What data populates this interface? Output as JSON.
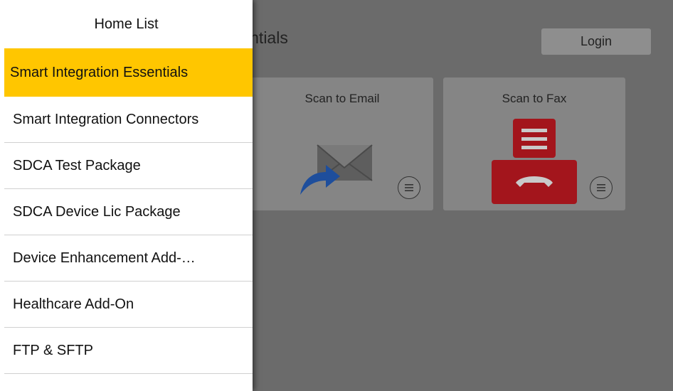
{
  "app": {
    "page_title": "Essentials",
    "login_label": "Login",
    "tiles": [
      {
        "label": "Scan to Email",
        "icon": "scan-to-email-icon"
      },
      {
        "label": "Scan to Fax",
        "icon": "fax-icon"
      }
    ]
  },
  "drawer": {
    "title": "Home List",
    "items": [
      {
        "label": "Smart Integration Essentials",
        "selected": true
      },
      {
        "label": "Smart Integration Connectors"
      },
      {
        "label": "SDCA Test Package"
      },
      {
        "label": "SDCA Device Lic Package"
      },
      {
        "label": "Device Enhancement Add-…"
      },
      {
        "label": "Healthcare Add-On"
      },
      {
        "label": "FTP & SFTP"
      }
    ]
  },
  "colors": {
    "selected_bg": "#ffc600",
    "overlay_bg": "#6b6b6b",
    "fax_red": "#a3151c",
    "arrow_blue": "#1e4e9c"
  }
}
